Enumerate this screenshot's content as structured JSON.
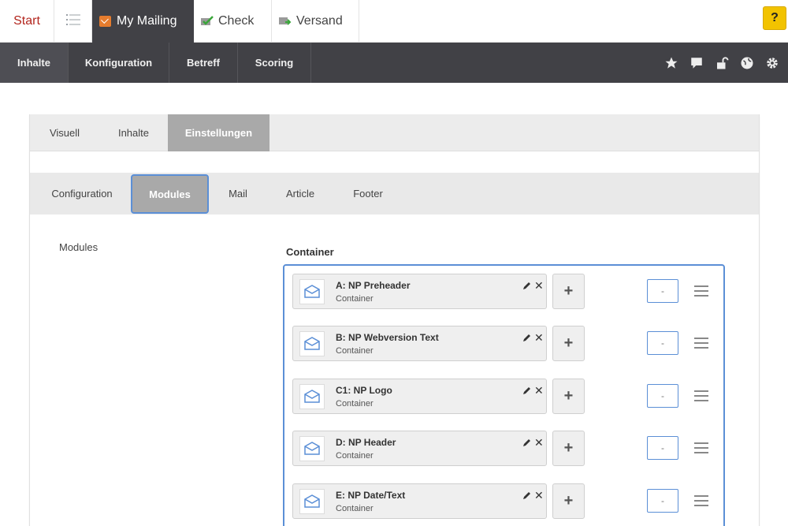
{
  "top_tabs": {
    "start": "Start",
    "my_mailing": "My Mailing",
    "check": "Check",
    "versand": "Versand"
  },
  "help_label": "?",
  "nav_tabs": {
    "inhalte": "Inhalte",
    "konfiguration": "Konfiguration",
    "betreff": "Betreff",
    "scoring": "Scoring"
  },
  "nav_icons": [
    "star-icon",
    "comment-icon",
    "unlock-icon",
    "globe-icon",
    "gear-icon"
  ],
  "view_tabs": {
    "visuell": "Visuell",
    "inhalte": "Inhalte",
    "einstellungen": "Einstellungen"
  },
  "settings_tabs": {
    "configuration": "Configuration",
    "modules": "Modules",
    "mail": "Mail",
    "article": "Article",
    "footer": "Footer"
  },
  "modules_label": "Modules",
  "container_title": "Container",
  "items": [
    {
      "title": "A: NP Preheader",
      "subtitle": "Container",
      "value": "-"
    },
    {
      "title": "B: NP Webversion Text",
      "subtitle": "Container",
      "value": "-"
    },
    {
      "title": "C1: NP Logo",
      "subtitle": "Container",
      "value": "-"
    },
    {
      "title": "D: NP Header",
      "subtitle": "Container",
      "value": "-"
    },
    {
      "title": "E: NP Date/Text",
      "subtitle": "Container",
      "value": "-"
    }
  ],
  "add_symbol": "+",
  "close_symbol": "✕",
  "colors": {
    "nav_dark": "#414146",
    "accent_blue": "#5b8fd6",
    "help_yellow": "#f2c300",
    "start_red": "#b3261e",
    "mail_orange": "#e57c2e"
  }
}
